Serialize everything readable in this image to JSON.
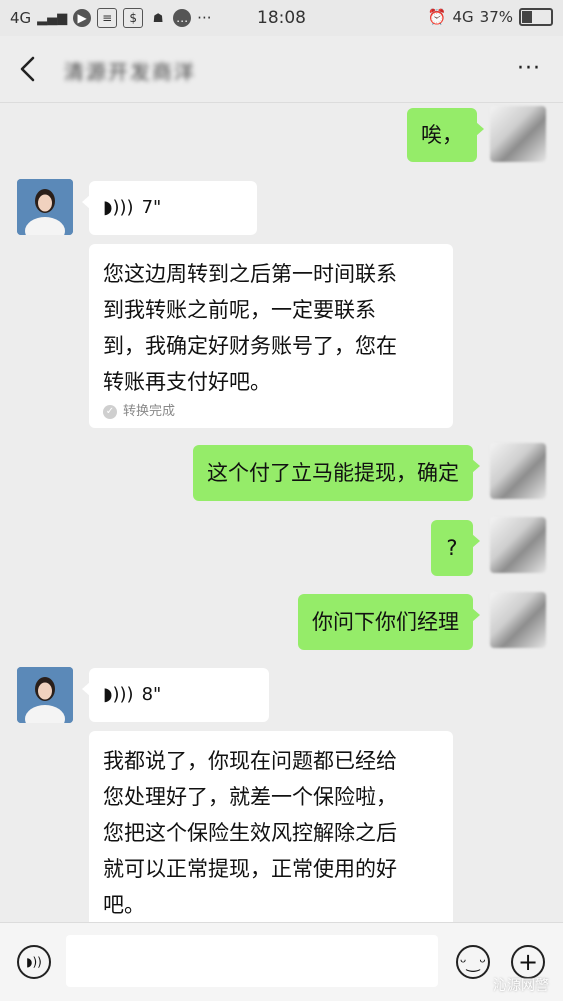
{
  "status_bar": {
    "network_left": "4G",
    "time": "18:08",
    "network_right": "4G",
    "battery": "37%",
    "battery_level": 0.37
  },
  "header": {
    "title": "清源开发商洋",
    "more_label": "···"
  },
  "messages": [
    {
      "from": "me",
      "type": "text",
      "text": "唉，"
    },
    {
      "from": "other",
      "type": "voice",
      "duration": "7\""
    },
    {
      "from": "other",
      "type": "transcript",
      "lines": [
        "您这边周转到之后第一时间联系",
        "到我转账之前呢，一定要联系",
        "到，我确定好财务账号了，您在",
        "转账再支付好吧。"
      ],
      "status": "转换完成"
    },
    {
      "from": "me",
      "type": "text",
      "text": "这个付了立马能提现，确定"
    },
    {
      "from": "me",
      "type": "text",
      "text": "?"
    },
    {
      "from": "me",
      "type": "text",
      "text": "你问下你们经理"
    },
    {
      "from": "other",
      "type": "voice",
      "duration": "8\""
    },
    {
      "from": "other",
      "type": "transcript",
      "lines": [
        "我都说了，你现在问题都已经给",
        "您处理好了，就差一个保险啦，",
        "您把这个保险生效风控解除之后",
        "就可以正常提现，正常使用的好",
        "吧。"
      ]
    }
  ],
  "watermark": "沁源网警"
}
